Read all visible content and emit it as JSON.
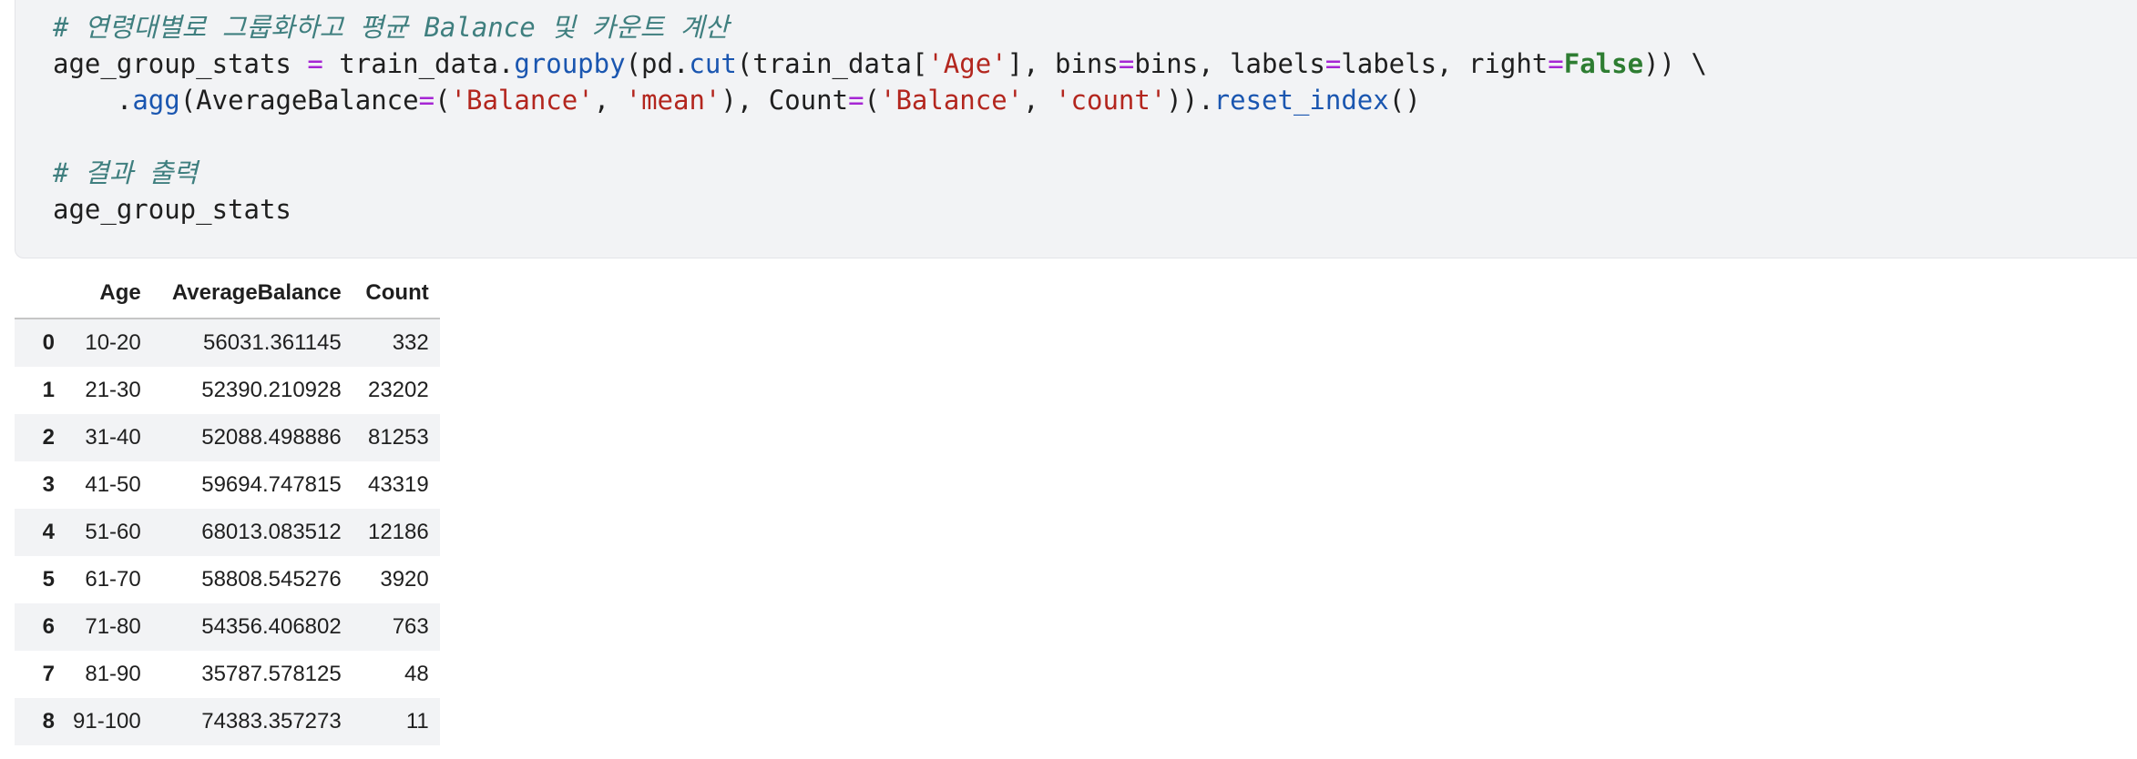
{
  "code_cell": {
    "line1": {
      "comment": "# 연령대별로 그룹화하고 평균 Balance 및 카운트 계산"
    },
    "line2": {
      "t1": "age_group_stats ",
      "op1": "=",
      "t2": " train_data.",
      "fn1": "groupby",
      "t3": "(pd.",
      "fn2": "cut",
      "t4": "(train_data[",
      "s1": "'Age'",
      "t5": "], bins",
      "op2": "=",
      "t6": "bins, labels",
      "op3": "=",
      "t7": "labels, right",
      "op4": "=",
      "kw1": "False",
      "t8": ")) \\"
    },
    "line3": {
      "t1": "    .",
      "fn1": "agg",
      "t2": "(AverageBalance",
      "op1": "=",
      "t3": "(",
      "s1": "'Balance'",
      "t4": ", ",
      "s2": "'mean'",
      "t5": "), Count",
      "op2": "=",
      "t6": "(",
      "s3": "'Balance'",
      "t7": ", ",
      "s4": "'count'",
      "t8": ")).",
      "fn2": "reset_index",
      "t9": "()"
    },
    "line5": {
      "comment": "# 결과 출력"
    },
    "line6": {
      "text": "age_group_stats"
    }
  },
  "output_table": {
    "columns": [
      "",
      "Age",
      "AverageBalance",
      "Count"
    ],
    "rows": [
      {
        "index": "0",
        "age": "10-20",
        "avg": "56031.361145",
        "count": "332"
      },
      {
        "index": "1",
        "age": "21-30",
        "avg": "52390.210928",
        "count": "23202"
      },
      {
        "index": "2",
        "age": "31-40",
        "avg": "52088.498886",
        "count": "81253"
      },
      {
        "index": "3",
        "age": "41-50",
        "avg": "59694.747815",
        "count": "43319"
      },
      {
        "index": "4",
        "age": "51-60",
        "avg": "68013.083512",
        "count": "12186"
      },
      {
        "index": "5",
        "age": "61-70",
        "avg": "58808.545276",
        "count": "3920"
      },
      {
        "index": "6",
        "age": "71-80",
        "avg": "54356.406802",
        "count": "763"
      },
      {
        "index": "7",
        "age": "81-90",
        "avg": "35787.578125",
        "count": "48"
      },
      {
        "index": "8",
        "age": "91-100",
        "avg": "74383.357273",
        "count": "11"
      }
    ]
  },
  "colors": {
    "cell_background": "#f2f3f5",
    "comment": "#3f7f7f",
    "function": "#1a56b0",
    "string": "#b3261e",
    "operator": "#a626d4",
    "keyword": "#2e7d32"
  }
}
